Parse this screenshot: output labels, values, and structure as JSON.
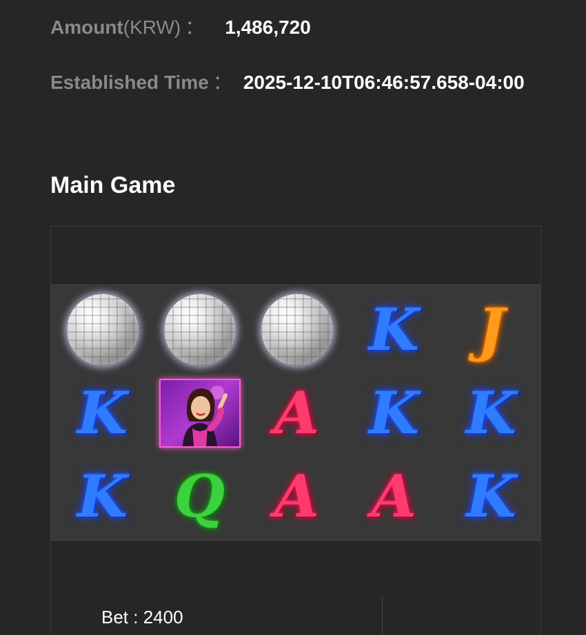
{
  "info": {
    "amount_label": "Amount",
    "amount_unit": "(KRW)",
    "amount_colon": "：",
    "amount_value": "1,486,720",
    "time_label": "Established Time",
    "time_colon": "：",
    "time_value": "2025-12-10T06:46:57.658-04:00"
  },
  "section": {
    "title": "Main Game"
  },
  "reels": {
    "rows": [
      [
        {
          "type": "disco-ball",
          "icon": "disco-ball-icon"
        },
        {
          "type": "disco-ball",
          "icon": "disco-ball-icon"
        },
        {
          "type": "disco-ball",
          "icon": "disco-ball-icon"
        },
        {
          "type": "letter",
          "symbol": "K",
          "color": "#2f7cff"
        },
        {
          "type": "letter",
          "symbol": "J",
          "color": "#ff9a1a"
        }
      ],
      [
        {
          "type": "letter",
          "symbol": "K",
          "color": "#2f7cff"
        },
        {
          "type": "wild",
          "icon": "woman-portrait-icon"
        },
        {
          "type": "letter",
          "symbol": "A",
          "color": "#ff3b6e"
        },
        {
          "type": "letter",
          "symbol": "K",
          "color": "#2f7cff"
        },
        {
          "type": "letter",
          "symbol": "K",
          "color": "#2f7cff"
        }
      ],
      [
        {
          "type": "letter",
          "symbol": "K",
          "color": "#2f7cff"
        },
        {
          "type": "letter",
          "symbol": "Q",
          "color": "#3ed13e"
        },
        {
          "type": "letter",
          "symbol": "A",
          "color": "#ff3b6e"
        },
        {
          "type": "letter",
          "symbol": "A",
          "color": "#ff3b6e"
        },
        {
          "type": "letter",
          "symbol": "K",
          "color": "#2f7cff"
        }
      ]
    ]
  },
  "bet": {
    "text": "Bet : 2400"
  }
}
